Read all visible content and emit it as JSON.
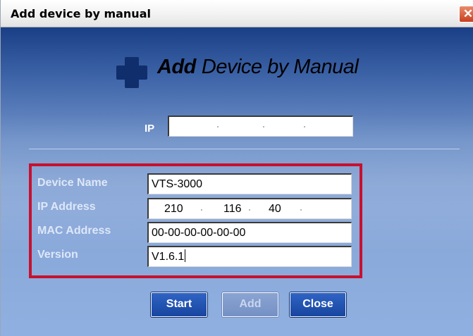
{
  "window": {
    "title": "Add device by manual",
    "close_glyph": "✕",
    "colors": {
      "close": "#c7401f",
      "highlight": "#c8102e",
      "button": "#1f50b0"
    }
  },
  "header": {
    "icon": "plus-icon",
    "title_bold": "Add",
    "title_rest": "Device by Manual"
  },
  "ip_lookup": {
    "label": "IP",
    "value": ""
  },
  "form": {
    "device_name": {
      "label": "Device Name",
      "value": "VTS-3000"
    },
    "ip_address": {
      "label": "IP Address",
      "octets": [
        "210",
        "116",
        "40",
        ""
      ]
    },
    "mac_address": {
      "label": "MAC Address",
      "value": "00-00-00-00-00-00"
    },
    "version": {
      "label": "Version",
      "value": "V1.6.1"
    }
  },
  "buttons": {
    "start": "Start",
    "add": "Add",
    "close": "Close"
  }
}
